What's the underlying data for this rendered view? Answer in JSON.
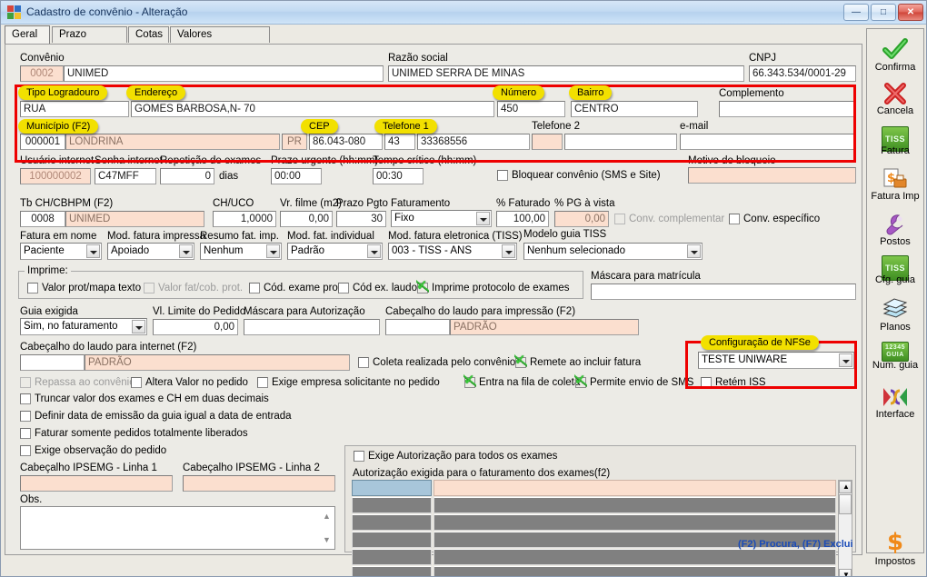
{
  "window": {
    "title": "Cadastro de convênio - Alteração",
    "minimize": "—",
    "maximize": "❐",
    "close": "✕"
  },
  "tabs": [
    {
      "label": "Geral",
      "active": true
    },
    {
      "label": "Prazo Entrega",
      "active": false
    },
    {
      "label": "Cotas",
      "active": false
    },
    {
      "label": "Valores diferenciados",
      "active": false
    }
  ],
  "callouts": [
    {
      "label": "Tipo Logradouro"
    },
    {
      "label": "Endereço"
    },
    {
      "label": "Número"
    },
    {
      "label": "Bairro"
    },
    {
      "label": "Município (F2)"
    },
    {
      "label": "CEP"
    },
    {
      "label": "Telefone 1"
    },
    {
      "label": "Configuração de NFSe"
    }
  ],
  "form": {
    "convenio_label": "Convênio",
    "convenio_code": "0002",
    "convenio_name": "UNIMED",
    "razao_label": "Razão social",
    "razao_value": "UNIMED SERRA DE  MINAS",
    "cnpj_label": "CNPJ",
    "cnpj_value": "66.343.534/0001-29",
    "tipo_logradouro_value": "RUA",
    "endereco_value": "GOMES BARBOSA,N- 70",
    "numero_value": "450",
    "bairro_value": "CENTRO",
    "complemento_label": "Complemento",
    "complemento_value": "",
    "municipio_code": "000001",
    "municipio_name": "LONDRINA",
    "uf_value": "PR",
    "cep_value": "86.043-080",
    "tel1_ddd": "43",
    "tel1_value": "33368556",
    "tel2_label": "Telefone 2",
    "tel2_ddd": "",
    "tel2_value": "",
    "email_label": "e-mail",
    "email_value": "",
    "usuario_internet_label": "Usuário internet",
    "usuario_internet_value": "100000002",
    "senha_internet_label": "Senha internet",
    "senha_internet_value": "C47MFF",
    "repeticao_label": "Repetição de exames",
    "repeticao_value": "0",
    "dias_label": "dias",
    "prazo_urgente_label": "Prazo urgente (hh:mm)",
    "prazo_urgente_value": "00:00",
    "tempo_critico_label": "Tempo crítico (hh:mm)",
    "tempo_critico_value": "00:30",
    "motivo_bloqueio_label": "Motivo do bloqueio",
    "motivo_bloqueio_value": "",
    "bloquear_convenio_label": "Bloquear convênio (SMS e Site)",
    "tb_ch_label": "Tb CH/CBHPM (F2)",
    "tb_ch_code": "0008",
    "tb_ch_name": "UNIMED",
    "ch_uco_label": "CH/UCO",
    "ch_uco_value": "1,0000",
    "vr_filme_label": "Vr. filme (m2)",
    "vr_filme_value": "0,00",
    "prazo_pgto_label": "Prazo Pgto",
    "prazo_pgto_value": "30",
    "faturamento_label": "Faturamento",
    "faturamento_value": "Fixo",
    "pct_faturado_label": "% Faturado",
    "pct_faturado_value": "100,00",
    "pct_pg_vista_label": "% PG à vista",
    "pct_pg_vista_value": "0,00",
    "conv_complementar_label": "Conv. complementar",
    "conv_especifico_label": "Conv. específico",
    "fatura_em_nome_label": "Fatura em nome",
    "fatura_em_nome_value": "Paciente",
    "mod_fatura_impressa_label": "Mod. fatura impressa",
    "mod_fatura_impressa_value": "Apoiado",
    "resumo_fat_imp_label": "Resumo fat. imp.",
    "resumo_fat_imp_value": "Nenhum",
    "mod_fat_individual_label": "Mod. fat. individual",
    "mod_fat_individual_value": "Padrão",
    "mod_fatura_eletronica_label": "Mod. fatura eletronica (TISS)",
    "mod_fatura_eletronica_value": "003 - TISS - ANS",
    "modelo_guia_tiss_label": "Modelo guia TISS",
    "modelo_guia_tiss_value": "Nenhum selecionado",
    "imprime_group_label": "Imprime:",
    "imprime_checks": [
      {
        "label": "Valor prot/mapa texto",
        "checked": false,
        "disabled": false
      },
      {
        "label": "Valor fat/cob. prot.",
        "checked": false,
        "disabled": true
      },
      {
        "label": "Cód. exame prot.",
        "checked": false,
        "disabled": false
      },
      {
        "label": "Cód  ex. laudo",
        "checked": false,
        "disabled": false
      },
      {
        "label": "Imprime protocolo de exames",
        "checked": true,
        "disabled": false
      }
    ],
    "mascara_matricula_label": "Máscara para matrícula",
    "mascara_matricula_value": "",
    "guia_exigida_label": "Guia exigida",
    "guia_exigida_value": "Sim, no faturamento",
    "vl_limite_label": "Vl. Limite do Pedido",
    "vl_limite_value": "0,00",
    "mascara_autorizacao_label": "Máscara para Autorização",
    "mascara_autorizacao_value": "",
    "cab_laudo_impressao_label": "Cabeçalho do laudo para impressão (F2)",
    "cab_laudo_impressao_code": "",
    "cab_laudo_impressao_name": "PADRÃO",
    "cab_laudo_internet_label": "Cabeçalho do laudo para internet (F2)",
    "cab_laudo_internet_code": "",
    "cab_laudo_internet_name": "PADRÃO",
    "coleta_convenio_label": "Coleta realizada pelo convênio",
    "remete_incluir_fatura_label": "Remete ao incluir fatura",
    "repassa_convenio_label": "Repassa ao convênio",
    "altera_valor_label": "Altera Valor no pedido",
    "exige_empresa_label": "Exige empresa solicitante no pedido",
    "entra_fila_coleta_label": "Entra na fila de coleta",
    "permite_sms_label": "Permite envio de SMS",
    "nfse_config_value": "TESTE UNIWARE",
    "retem_iss_label": "Retém ISS",
    "left_checks": [
      {
        "label": "Truncar valor dos exames e CH em duas decimais",
        "checked": false
      },
      {
        "label": "Definir data de emissão da guia igual a data de entrada",
        "checked": false
      },
      {
        "label": "Faturar somente pedidos totalmente liberados",
        "checked": false
      },
      {
        "label": "Exige observação do pedido",
        "checked": false
      }
    ],
    "cab_ipsemg1_label": "Cabeçalho IPSEMG - Linha 1",
    "cab_ipsemg1_value": "",
    "cab_ipsemg2_label": "Cabeçalho IPSEMG - Linha 2",
    "cab_ipsemg2_value": "",
    "obs_label": "Obs.",
    "obs_value": "",
    "exige_autorizacao_todos_label": "Exige Autorização para todos os exames",
    "autorizacao_exigida_label": "Autorização exigida para o faturamento dos exames(f2)",
    "grid_rows": [
      {
        "col1": "",
        "col2": "",
        "selected": true
      },
      {
        "col1": "",
        "col2": "",
        "selected": false
      },
      {
        "col1": "",
        "col2": "",
        "selected": false
      },
      {
        "col1": "",
        "col2": "",
        "selected": false
      },
      {
        "col1": "",
        "col2": "",
        "selected": false
      },
      {
        "col1": "",
        "col2": "",
        "selected": false
      }
    ],
    "grid_hint": "(F2) Procura, (F7) Exclui"
  },
  "toolbar": [
    {
      "label": "Confirma",
      "icon": "check-icon"
    },
    {
      "label": "Cancela",
      "icon": "cross-icon"
    },
    {
      "label": "Fatura",
      "icon": "tiss-icon"
    },
    {
      "label": "Fatura Imp",
      "icon": "invoice-print-icon"
    },
    {
      "label": "Postos",
      "icon": "wrench-icon"
    },
    {
      "label": "Cfg. guia",
      "icon": "tiss-config-icon"
    },
    {
      "label": "Planos",
      "icon": "layers-icon"
    },
    {
      "label": "Num. guia",
      "icon": "guia-number-icon"
    },
    {
      "label": "Interface",
      "icon": "interface-icon"
    },
    {
      "label": "Impostos",
      "icon": "dollar-icon"
    }
  ],
  "colors": {
    "highlight_red": "#ee0000",
    "callout_yellow": "#f2e000",
    "readonly_pink": "#fbdfcf",
    "selected_blue": "#a8c6da",
    "grid_gray": "#808080"
  }
}
